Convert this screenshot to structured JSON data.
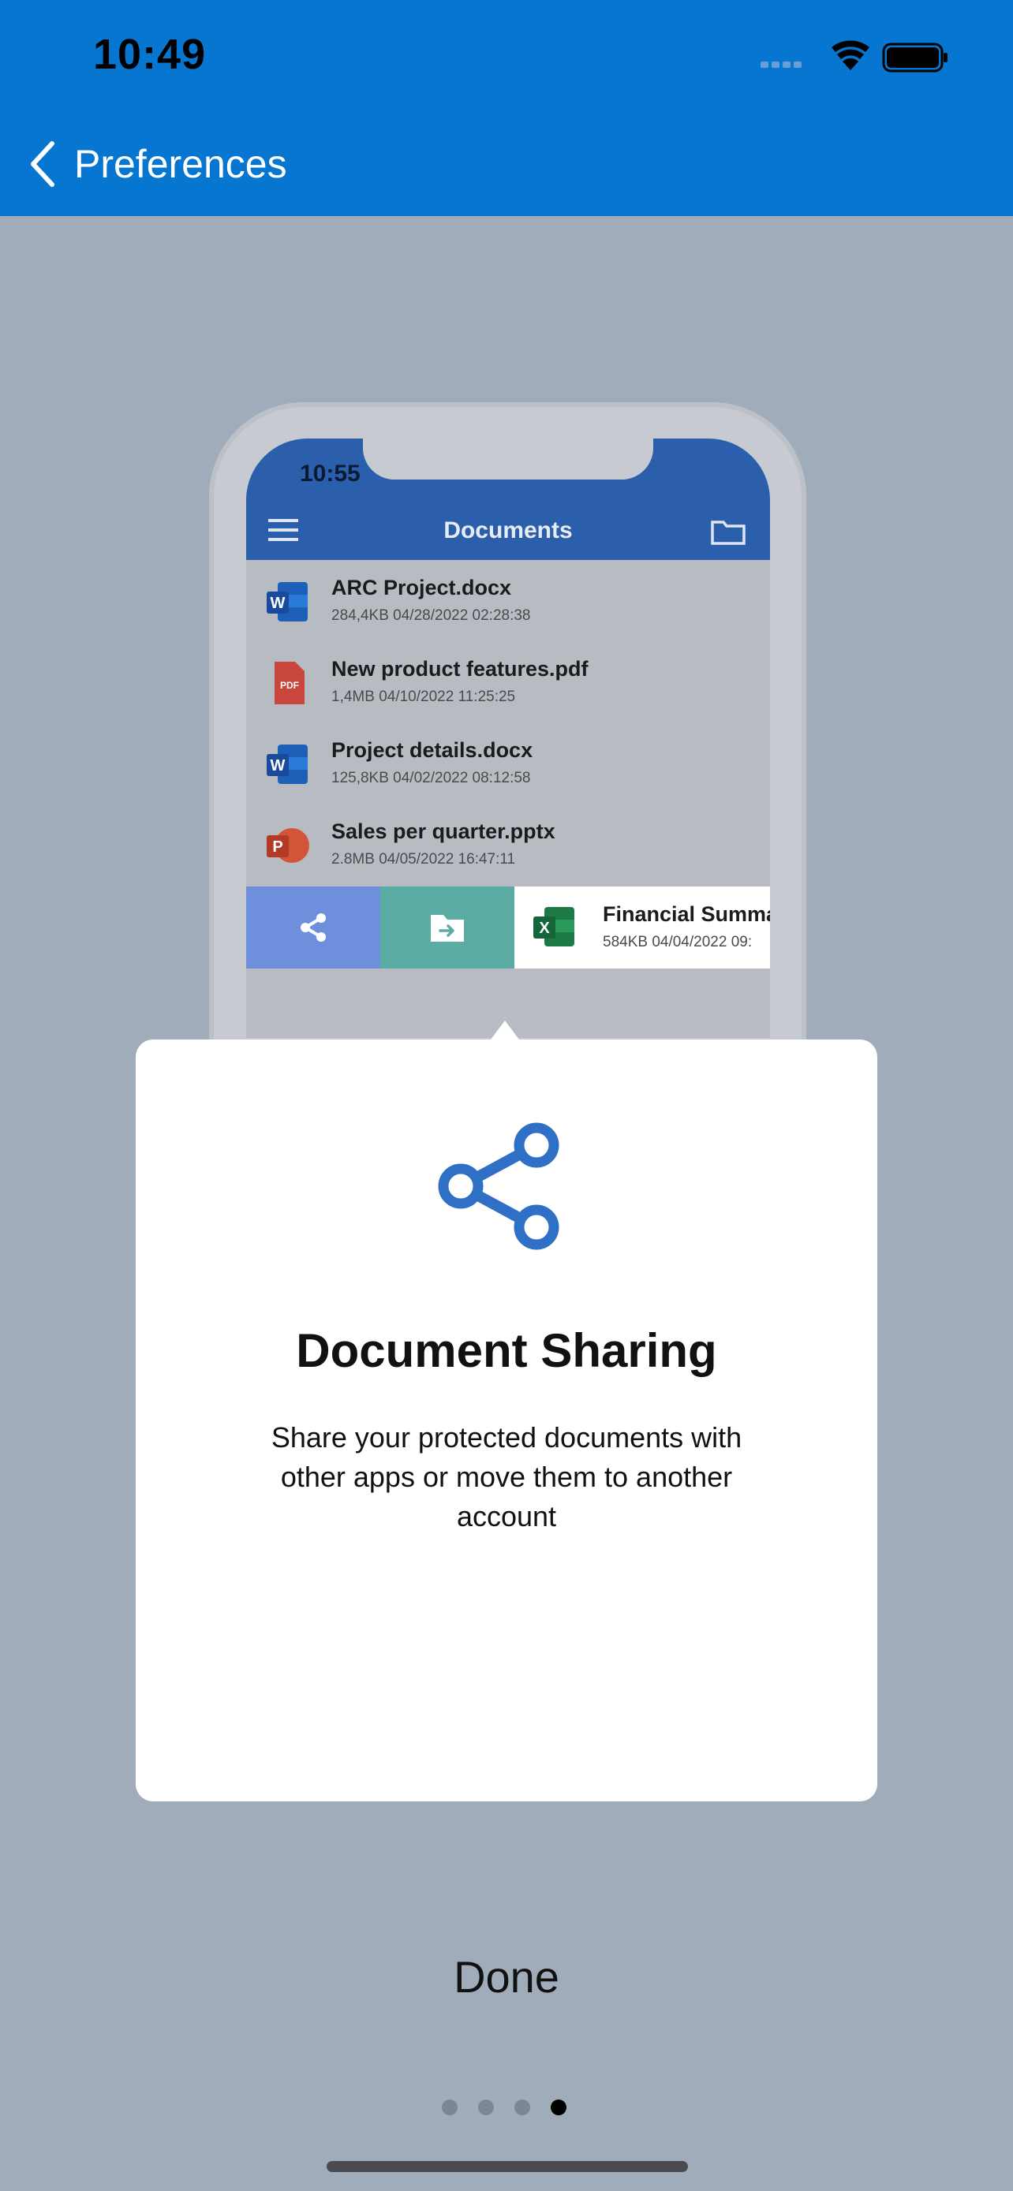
{
  "status_bar": {
    "time": "10:49"
  },
  "nav": {
    "back_label": "Preferences"
  },
  "phone_mockup": {
    "time": "10:55",
    "title": "Documents",
    "documents": [
      {
        "name": "ARC Project.docx",
        "meta": "284,4KB 04/28/2022 02:28:38",
        "icon": "word-icon"
      },
      {
        "name": "New product features.pdf",
        "meta": "1,4MB 04/10/2022 11:25:25",
        "icon": "pdf-icon"
      },
      {
        "name": "Project details.docx",
        "meta": "125,8KB 04/02/2022 08:12:58",
        "icon": "word-icon"
      },
      {
        "name": "Sales per quarter.pptx",
        "meta": "2.8MB 04/05/2022 16:47:11",
        "icon": "powerpoint-icon"
      }
    ],
    "swiped_document": {
      "name": "Financial Summary",
      "meta": "584KB 04/04/2022 09:",
      "icon": "excel-icon"
    }
  },
  "card": {
    "title": "Document Sharing",
    "description": "Share your protected documents with other apps or move them to another account"
  },
  "done_label": "Done",
  "pager": {
    "total": 4,
    "current": 4
  },
  "colors": {
    "header": "#0676d0",
    "background": "#a0acba",
    "accent": "#2f6fc6"
  }
}
